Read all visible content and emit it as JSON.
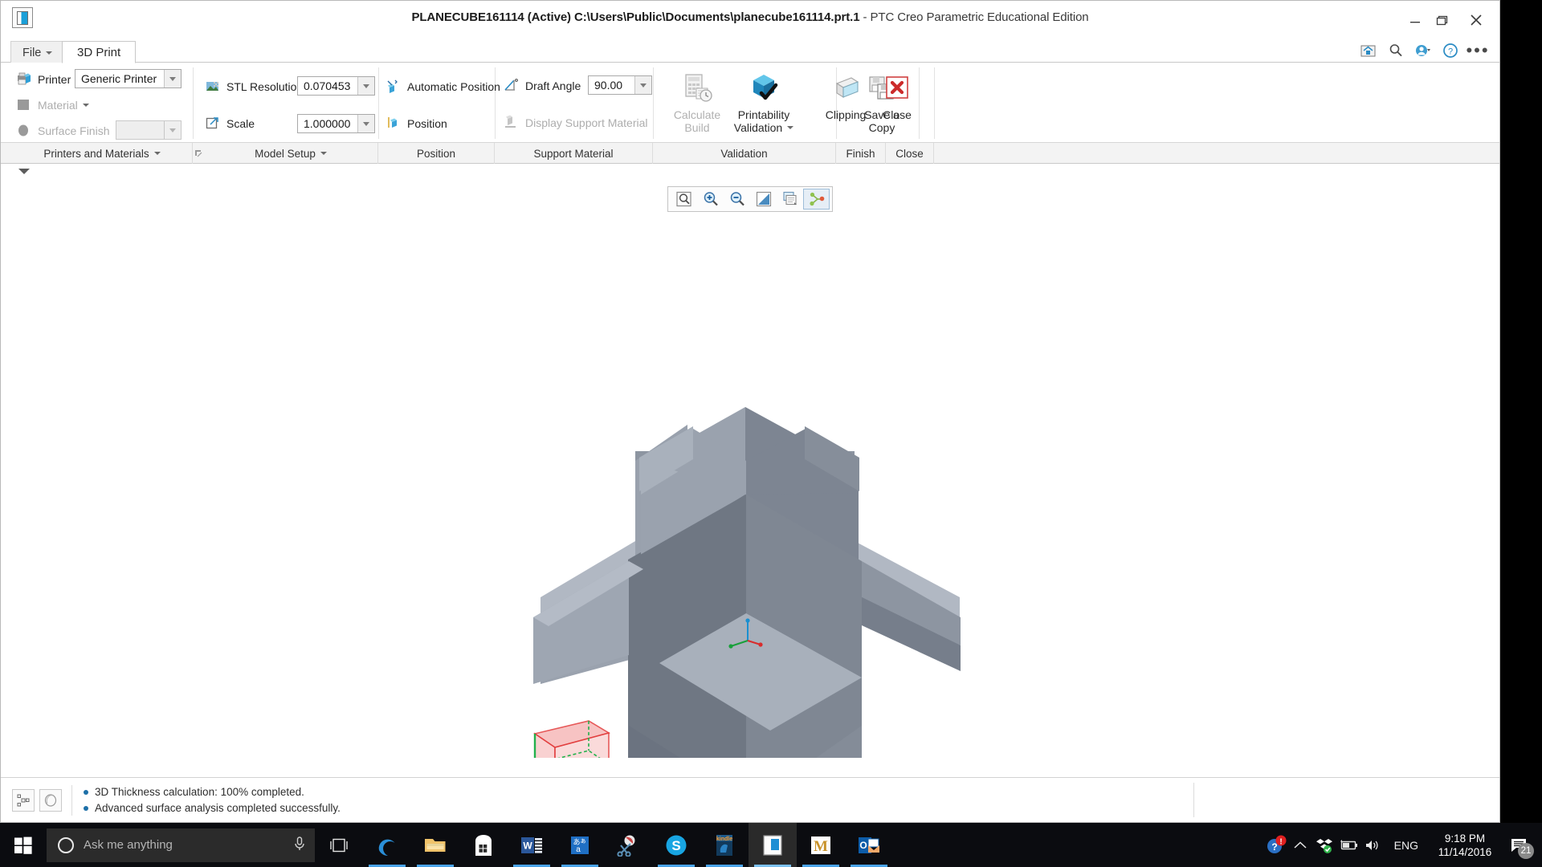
{
  "window": {
    "title": "PLANECUBE161114 (Active) C:\\Users\\Public\\Documents\\planecube161114.prt.1 - PTC Creo Parametric Educational Edition",
    "title_main": "PLANECUBE161114 (Active) C:\\Users\\Public\\Documents\\planecube161114.prt.1",
    "title_suffix": " - PTC Creo Parametric Educational Edition",
    "app_icon": "creo-app-icon",
    "minimize": "minimize-icon",
    "maximize": "maximize-icon",
    "close": "close-icon"
  },
  "tabs": [
    {
      "label": "File",
      "has_caret": true,
      "active": false
    },
    {
      "label": "3D Print",
      "has_caret": false,
      "active": true
    }
  ],
  "quick_access": [
    {
      "icon": "home-window-icon"
    },
    {
      "icon": "search-icon"
    },
    {
      "icon": "user-status-icon"
    },
    {
      "icon": "help-icon"
    },
    {
      "icon": "more-options-icon"
    }
  ],
  "ribbon": {
    "groups": [
      {
        "caption": "Printers and Materials",
        "has_caret": true,
        "has_launcher": true
      },
      {
        "caption": "Model Setup",
        "has_caret": true,
        "has_launcher": false
      },
      {
        "caption": "Position",
        "has_caret": false,
        "has_launcher": false
      },
      {
        "caption": "Support Material",
        "has_caret": false,
        "has_launcher": false
      },
      {
        "caption": "Validation",
        "has_caret": false,
        "has_launcher": false
      },
      {
        "caption": "Finish",
        "has_caret": false,
        "has_launcher": false
      },
      {
        "caption": "Close",
        "has_caret": false,
        "has_launcher": false
      }
    ],
    "printers_and_materials": {
      "printer_label": "Printer",
      "printer_icon": "printer-icon",
      "printer_value": "Generic Printer",
      "material_label": "Material",
      "material_icon": "material-swatch-icon",
      "material_value": "",
      "surface_finish_label": "Surface Finish",
      "surface_finish_icon": "surface-finish-icon",
      "surface_finish_value": ""
    },
    "model_setup": {
      "stl_resolution_label": "STL Resolution",
      "stl_resolution_icon": "stl-resolution-icon",
      "stl_resolution_value": "0.070453",
      "scale_label": "Scale",
      "scale_icon": "scale-icon",
      "scale_value": "1.000000"
    },
    "position": {
      "automatic_position_label": "Automatic Position",
      "automatic_position_icon": "automatic-position-icon",
      "position_label": "Position",
      "position_icon": "position-icon"
    },
    "support_material": {
      "draft_angle_label": "Draft Angle",
      "draft_angle_icon": "draft-angle-icon",
      "draft_angle_value": "90.00",
      "display_support_label": "Display Support Material",
      "display_support_icon": "display-support-icon",
      "display_support_enabled": false
    },
    "validation": {
      "calculate_build_label": "Calculate\nBuild",
      "calculate_build_line1": "Calculate",
      "calculate_build_line2": "Build",
      "calculate_build_icon": "calculate-build-icon",
      "calculate_build_enabled": false,
      "printability_line1": "Printability",
      "printability_line2": "Validation",
      "printability_icon": "printability-validation-icon",
      "printability_has_caret": true,
      "clipping_label": "Clipping",
      "clipping_icon": "clipping-icon"
    },
    "finish": {
      "save_copy_line1": "Save a",
      "save_copy_line2": "Copy",
      "save_copy_icon": "save-a-copy-icon"
    },
    "close": {
      "close_label": "Close",
      "close_icon": "close-x-icon"
    }
  },
  "graphics_toolbar": {
    "buttons": [
      {
        "icon": "zoom-to-fit-icon",
        "active": false
      },
      {
        "icon": "zoom-in-icon",
        "active": false
      },
      {
        "icon": "zoom-out-icon",
        "active": false
      },
      {
        "icon": "display-style-icon",
        "active": false
      },
      {
        "icon": "layers-icon",
        "active": false
      },
      {
        "icon": "datum-display-icon",
        "active": true
      }
    ]
  },
  "model": {
    "name": "planecube-3d-model",
    "body_color": "#9aa3b0",
    "body_shade_dark": "#6f7783",
    "body_shade_mid": "#878f9c",
    "body_shade_light": "#b3bbc6",
    "csys_colors": {
      "x": "#d92c2c",
      "y": "#18a03a",
      "z": "#1a8fd0"
    },
    "bounding_box_color": "#e23b3b"
  },
  "statusbar": {
    "icons": [
      "selection-filter-icon",
      "appearance-icon"
    ],
    "messages": [
      "3D Thickness calculation: 100% completed.",
      "Advanced surface analysis completed successfully."
    ]
  },
  "taskbar": {
    "start_icon": "windows-start-icon",
    "search_placeholder": "Ask me anything",
    "cortana_icon": "cortana-circle-icon",
    "mic_icon": "microphone-icon",
    "task_view_icon": "task-view-icon",
    "apps": [
      {
        "name": "edge",
        "running": true,
        "focused": false
      },
      {
        "name": "file-explorer",
        "running": true,
        "focused": false
      },
      {
        "name": "microsoft-store",
        "running": false,
        "focused": false
      },
      {
        "name": "word",
        "running": true,
        "focused": false
      },
      {
        "name": "ime-language",
        "running": true,
        "focused": false
      },
      {
        "name": "snipping-tool",
        "running": false,
        "focused": false
      },
      {
        "name": "skype",
        "running": true,
        "focused": false
      },
      {
        "name": "kindle",
        "running": true,
        "focused": false
      },
      {
        "name": "creo-parametric",
        "running": true,
        "focused": true
      },
      {
        "name": "mathcad",
        "running": true,
        "focused": false
      },
      {
        "name": "outlook",
        "running": true,
        "focused": false
      }
    ],
    "tray": {
      "alert_icon": "help-alert-icon",
      "chevron_icon": "show-hidden-icons-icon",
      "dropbox_icon": "dropbox-icon",
      "battery_icon": "battery-charging-icon",
      "volume_icon": "volume-icon",
      "language": "ENG",
      "time": "9:18 PM",
      "date": "11/14/2016",
      "action_center_icon": "action-center-icon",
      "notification_count": "21"
    }
  }
}
